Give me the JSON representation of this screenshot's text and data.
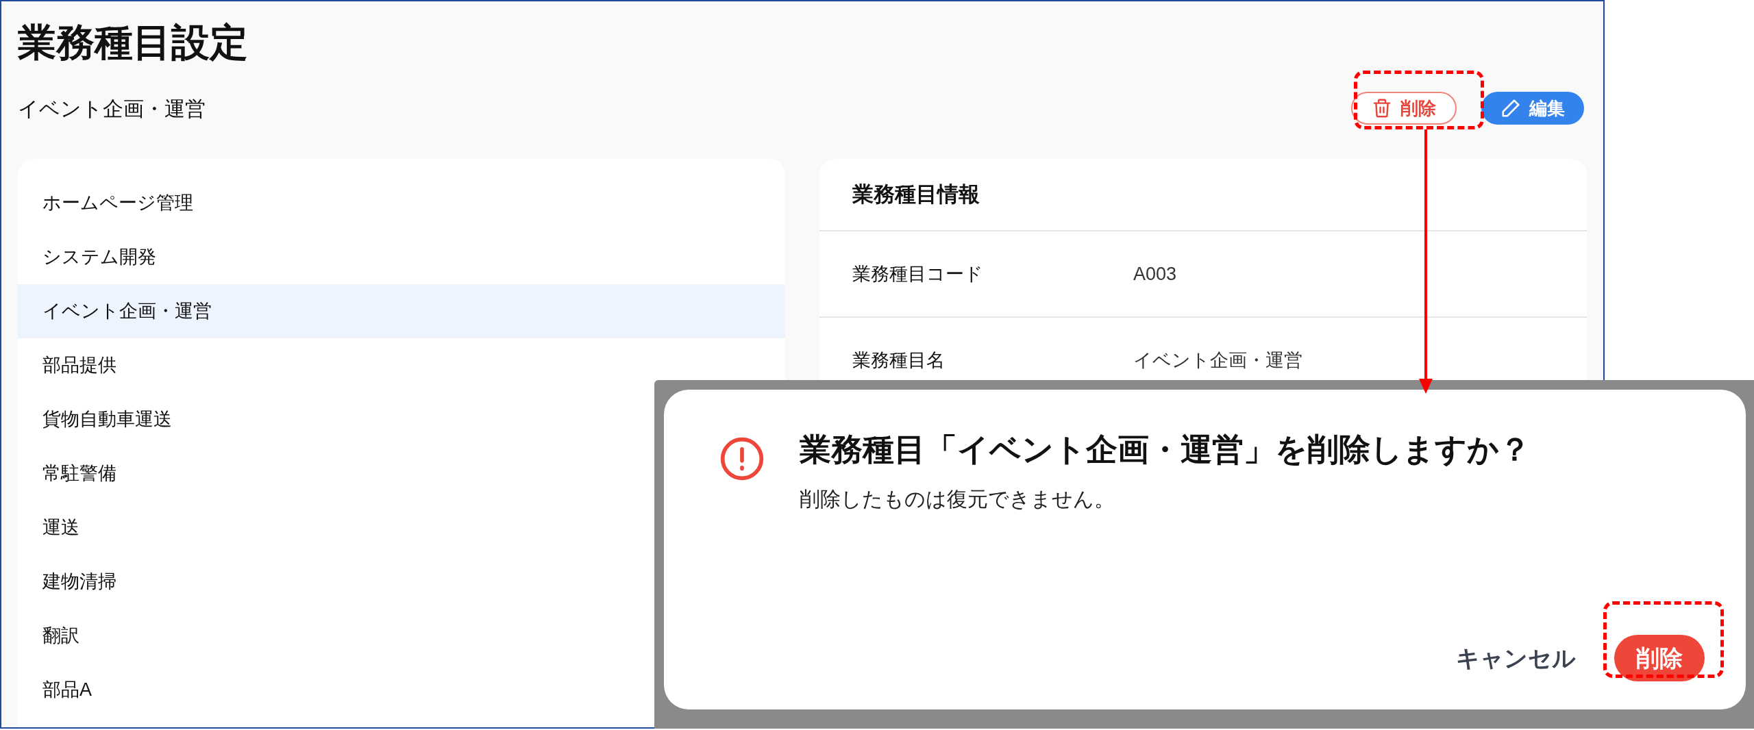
{
  "page": {
    "title": "業務種目設定",
    "subtitle": "イベント企画・運営"
  },
  "actions": [
    {
      "label": "削除",
      "kind": "delete"
    },
    {
      "label": "編集",
      "kind": "edit"
    }
  ],
  "sidebar": {
    "items": [
      {
        "label": "ホームページ管理",
        "selected": false
      },
      {
        "label": "システム開発",
        "selected": false
      },
      {
        "label": "イベント企画・運営",
        "selected": true
      },
      {
        "label": "部品提供",
        "selected": false
      },
      {
        "label": "貨物自動車運送",
        "selected": false
      },
      {
        "label": "常駐警備",
        "selected": false
      },
      {
        "label": "運送",
        "selected": false
      },
      {
        "label": "建物清掃",
        "selected": false
      },
      {
        "label": "翻訳",
        "selected": false
      },
      {
        "label": "部品A",
        "selected": false
      }
    ]
  },
  "detail": {
    "title": "業務種目情報",
    "rows": [
      {
        "label": "業務種目コード",
        "value": "A003"
      },
      {
        "label": "業務種目名",
        "value": "イベント企画・運営"
      }
    ]
  },
  "dialog": {
    "title": "業務種目「イベント企画・運営」を削除しますか？",
    "message": "削除したものは復元できません。",
    "buttons": [
      {
        "label": "キャンセル",
        "kind": "cancel"
      },
      {
        "label": "削除",
        "kind": "danger"
      }
    ]
  }
}
